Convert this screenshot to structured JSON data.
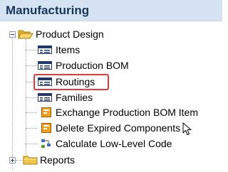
{
  "header": {
    "title": "Manufacturing"
  },
  "tree": {
    "root": {
      "label": "Product Design",
      "icon": "folder-open-icon",
      "toggle": "collapse"
    },
    "children": [
      {
        "label": "Items",
        "icon": "list-page-icon"
      },
      {
        "label": "Production BOM",
        "icon": "list-page-icon"
      },
      {
        "label": "Routings",
        "icon": "list-page-icon",
        "highlighted": true
      },
      {
        "label": "Families",
        "icon": "list-page-icon"
      },
      {
        "label": "Exchange Production BOM Item",
        "icon": "batch-job-icon"
      },
      {
        "label": "Delete Expired Components",
        "icon": "batch-job-icon"
      },
      {
        "label": "Calculate Low-Level Code",
        "icon": "codeunit-icon"
      }
    ],
    "sibling": {
      "label": "Reports",
      "icon": "folder-closed-icon",
      "toggle": "expand"
    }
  },
  "colors": {
    "header_bg": "#d6e3f3",
    "header_text": "#17365d",
    "highlight_border": "#e03c3c",
    "folder": "#f5c342"
  }
}
